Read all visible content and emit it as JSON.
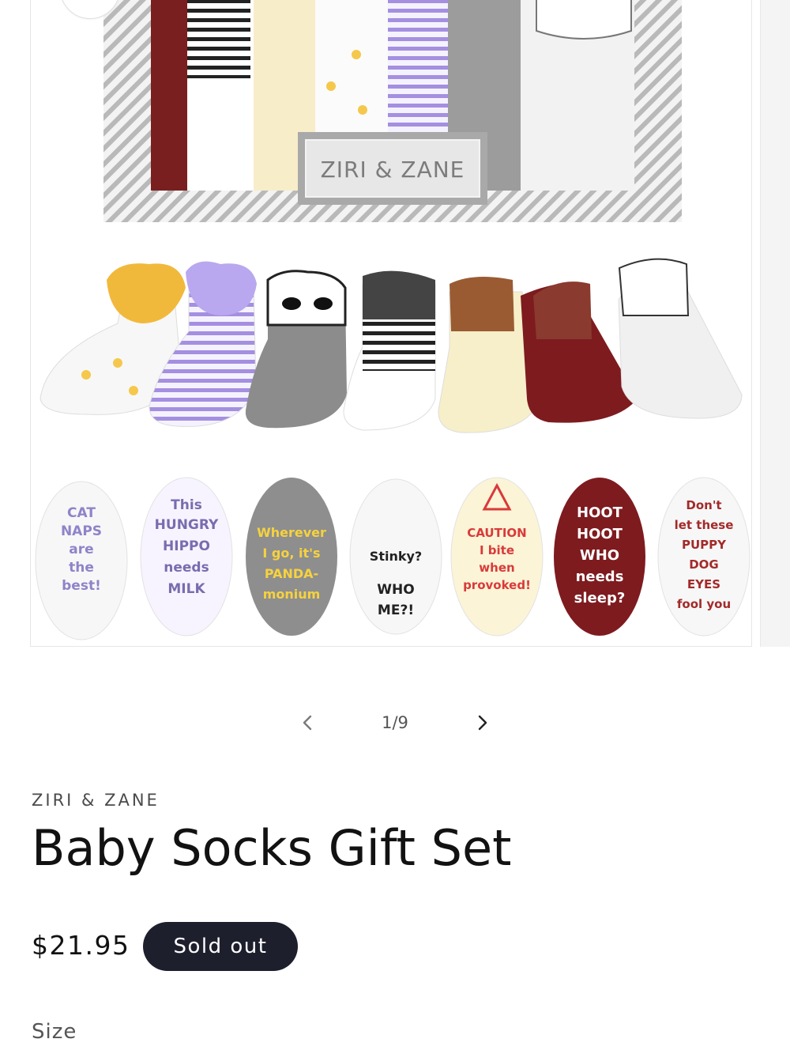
{
  "product_image": {
    "box_brand": "ZIRI & ZANE",
    "sole_messages": [
      "CAT NAPS are the best!",
      "This HUNGRY HIPPO needs MILK",
      "Wherever I go, it's PANDA-monium",
      "Stinky? WHO ME?!",
      "CAUTION I bite when provoked!",
      "HOOT HOOT WHO needs sleep?",
      "Don't let these PUPPY DOG EYES fool you"
    ]
  },
  "pager": {
    "count": "1/9",
    "prev_icon": "chevron-left-icon",
    "next_icon": "chevron-right-icon"
  },
  "product": {
    "vendor": "ZIRI & ZANE",
    "title": "Baby Socks Gift Set",
    "price": "$21.95",
    "badge": "Sold out",
    "size_label": "Size"
  },
  "colors": {
    "badge_bg": "#1e1f2d",
    "text": "#121212"
  }
}
